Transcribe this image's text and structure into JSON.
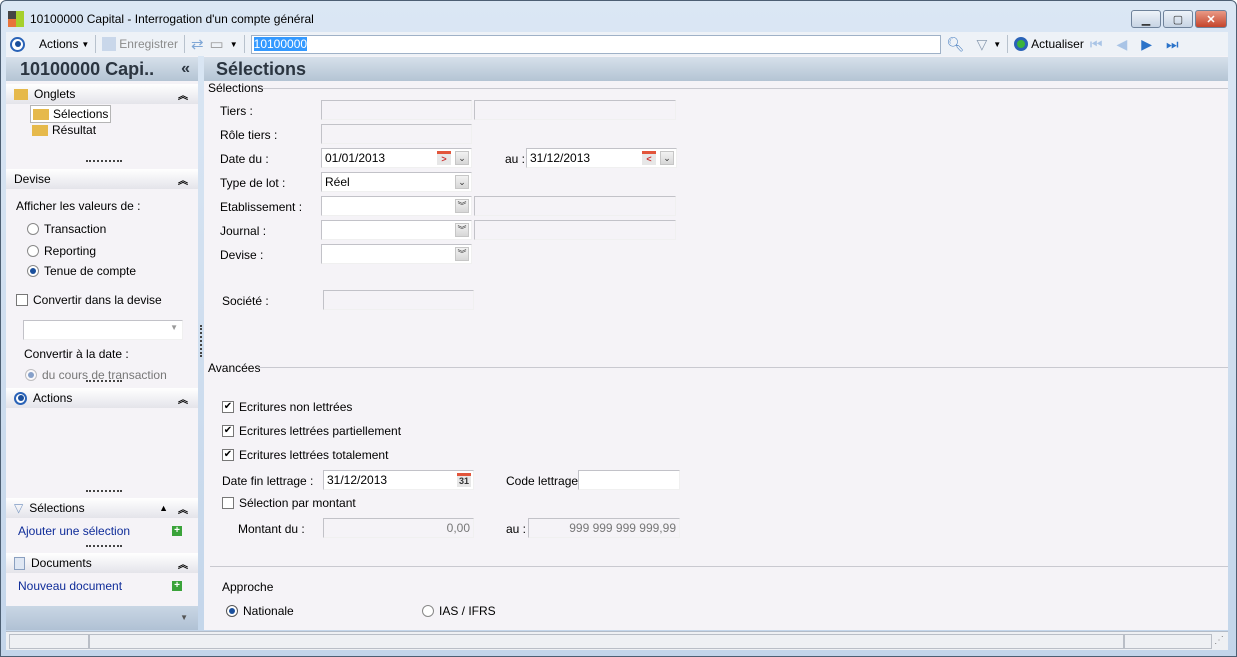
{
  "window": {
    "title": "10100000 Capital -  Interrogation d'un compte général",
    "min": "▁",
    "max": "▢",
    "close": "✕"
  },
  "toolbar": {
    "actions": "Actions",
    "save": "Enregistrer",
    "target_value": "10100000",
    "refresh": "Actualiser"
  },
  "sidebar": {
    "header": "10100000 Capi..",
    "collapse": "«",
    "onglets": {
      "title": "Onglets",
      "items": [
        "Sélections",
        "Résultat"
      ]
    },
    "devise": {
      "title": "Devise",
      "afficher": "Afficher les valeurs de :",
      "options": [
        "Transaction",
        "Reporting",
        "Tenue de compte"
      ],
      "selected": "Tenue de compte",
      "convertir": "Convertir dans la devise",
      "convertir_date": "Convertir à la date :",
      "cours": "du cours de transaction"
    },
    "actions": {
      "title": "Actions"
    },
    "selections": {
      "title": "Sélections",
      "link": "Ajouter une sélection"
    },
    "documents": {
      "title": "Documents",
      "link": "Nouveau document"
    }
  },
  "main": {
    "title": "Sélections",
    "selections": {
      "group": "Sélections",
      "tiers": "Tiers :",
      "role_tiers": "Rôle tiers :",
      "date_du": "Date du :",
      "date_du_value": "01/01/2013",
      "au": "au :",
      "date_au_value": "31/12/2013",
      "type_lot": "Type de lot :",
      "type_lot_value": "Réel",
      "etablissement": "Etablissement :",
      "journal": "Journal :",
      "devise": "Devise :",
      "societe": "Société :"
    },
    "avancees": {
      "group": "Avancées",
      "non_lettrees": "Ecritures non lettrées",
      "partiellement": "Ecritures lettrées partiellement",
      "totalement": "Ecritures lettrées totalement",
      "date_fin": "Date fin lettrage :",
      "date_fin_value": "31/12/2013",
      "code": "Code lettrage :",
      "par_montant": "Sélection par montant",
      "montant_du": "Montant du :",
      "montant_du_value": "0,00",
      "au": "au :",
      "montant_au_value": "999 999 999 999,99"
    },
    "approche": {
      "group": "Approche",
      "nationale": "Nationale",
      "ias": "IAS / IFRS",
      "selected": "Nationale"
    }
  }
}
